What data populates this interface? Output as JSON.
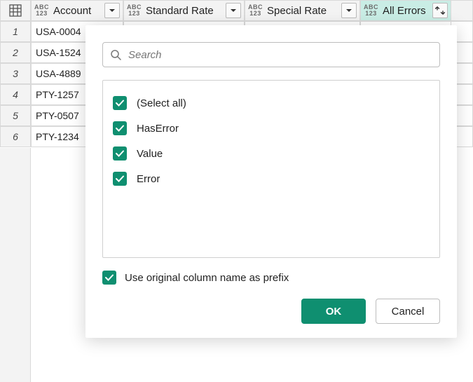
{
  "columns": [
    {
      "name": "Account"
    },
    {
      "name": "Standard Rate"
    },
    {
      "name": "Special Rate"
    },
    {
      "name": "All Errors",
      "active": true
    }
  ],
  "typeBadge": {
    "line1": "ABC",
    "line2": "123"
  },
  "rows": [
    {
      "n": "1",
      "account": "USA-0004"
    },
    {
      "n": "2",
      "account": "USA-1524"
    },
    {
      "n": "3",
      "account": "USA-4889"
    },
    {
      "n": "4",
      "account": "PTY-1257"
    },
    {
      "n": "5",
      "account": "PTY-0507"
    },
    {
      "n": "6",
      "account": "PTY-1234"
    }
  ],
  "dialog": {
    "searchPlaceholder": "Search",
    "options": [
      {
        "label": "(Select all)"
      },
      {
        "label": "HasError"
      },
      {
        "label": "Value"
      },
      {
        "label": "Error"
      }
    ],
    "prefixLabel": "Use original column name as prefix",
    "okLabel": "OK",
    "cancelLabel": "Cancel"
  }
}
